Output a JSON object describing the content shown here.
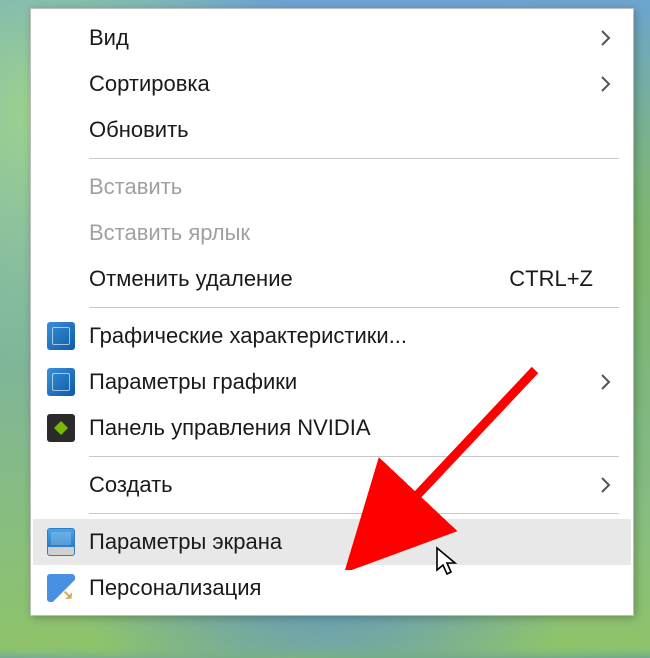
{
  "menu": {
    "items": [
      {
        "label": "Вид",
        "enabled": true,
        "submenu": true
      },
      {
        "label": "Сортировка",
        "enabled": true,
        "submenu": true
      },
      {
        "label": "Обновить",
        "enabled": true
      },
      {
        "type": "separator"
      },
      {
        "label": "Вставить",
        "enabled": false
      },
      {
        "label": "Вставить ярлык",
        "enabled": false
      },
      {
        "label": "Отменить удаление",
        "enabled": true,
        "shortcut": "CTRL+Z"
      },
      {
        "type": "separator"
      },
      {
        "label": "Графические характеристики...",
        "enabled": true,
        "icon": "intel-icon"
      },
      {
        "label": "Параметры графики",
        "enabled": true,
        "icon": "intel-icon",
        "submenu": true
      },
      {
        "label": "Панель управления NVIDIA",
        "enabled": true,
        "icon": "nvidia-icon"
      },
      {
        "type": "separator"
      },
      {
        "label": "Создать",
        "enabled": true,
        "submenu": true
      },
      {
        "type": "separator"
      },
      {
        "label": "Параметры экрана",
        "enabled": true,
        "icon": "display-icon",
        "hover": true
      },
      {
        "label": "Персонализация",
        "enabled": true,
        "icon": "personalize-icon"
      }
    ]
  },
  "annotation": {
    "arrow_color": "#ff0000"
  }
}
